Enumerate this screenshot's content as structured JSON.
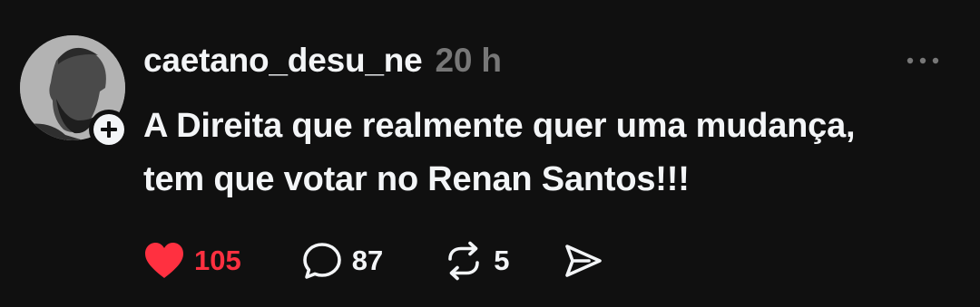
{
  "post": {
    "username": "caetano_desu_ne",
    "time": "20 h",
    "text_lines": [
      "A Direita que realmente quer uma mudança,",
      "tem que votar no Renan Santos!!!"
    ],
    "actions": {
      "like": {
        "icon": "heart-filled-icon",
        "count": "105",
        "liked": true,
        "color": "#ff3040"
      },
      "reply": {
        "icon": "comment-bubble-icon",
        "count": "87"
      },
      "repost": {
        "icon": "repost-arrows-icon",
        "count": "5"
      },
      "share": {
        "icon": "send-icon"
      }
    },
    "more_icon": "more-horizontal-icon",
    "follow_icon": "plus-icon"
  },
  "theme": {
    "background": "#101010",
    "text": "#f3f5f7",
    "muted": "#777777",
    "like_color": "#ff3040"
  }
}
